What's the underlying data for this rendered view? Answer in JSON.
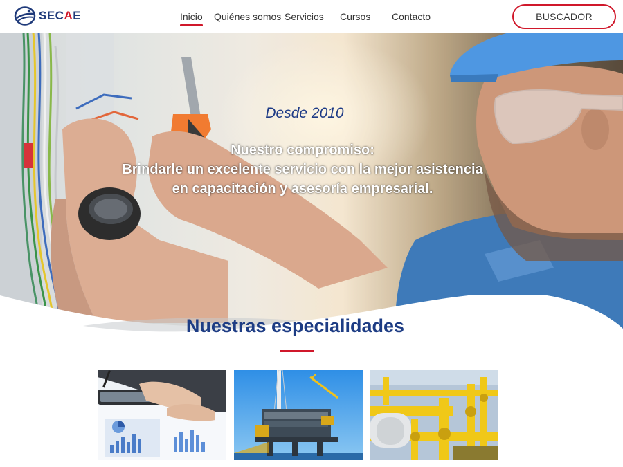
{
  "brand": {
    "name_main": "SEC",
    "name_accent": "A",
    "name_tail": "E"
  },
  "nav": {
    "items": [
      {
        "label": "Inicio",
        "active": true
      },
      {
        "label": "Quiénes somos",
        "active": false
      },
      {
        "label": "Servicios",
        "active": false
      },
      {
        "label": "Cursos",
        "active": false
      },
      {
        "label": "Contacto",
        "active": false
      }
    ],
    "search_label": "BUSCADOR"
  },
  "hero": {
    "subtitle": "Desde 2010",
    "title_line1": "Nuestro compromiso:",
    "title_line2": "Brindarle un excelente servicio con la mejor asistencia",
    "title_line3": "en capacitación y asesoría empresarial."
  },
  "specialties": {
    "title": "Nuestras especialidades",
    "cards": [
      {
        "image": "business-documents-photo"
      },
      {
        "image": "offshore-oil-platform-photo"
      },
      {
        "image": "industrial-pipes-photo"
      }
    ]
  },
  "colors": {
    "brand_blue": "#1d3c84",
    "accent_red": "#d0182b"
  }
}
